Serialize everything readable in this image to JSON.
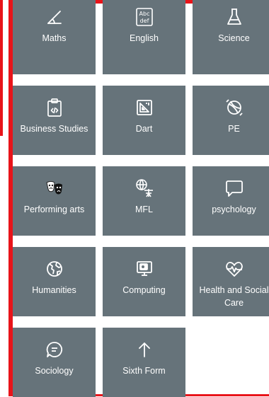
{
  "subjects": [
    {
      "label": "Maths",
      "icon": "angle-icon"
    },
    {
      "label": "English",
      "icon": "abc-def-icon"
    },
    {
      "label": "Science",
      "icon": "flask-icon"
    },
    {
      "label": "Business Studies",
      "icon": "clipboard-code-icon"
    },
    {
      "label": "Dart",
      "icon": "design-ruler-icon"
    },
    {
      "label": "PE",
      "icon": "ball-icon"
    },
    {
      "label": "Performing arts",
      "icon": "theatre-masks-icon"
    },
    {
      "label": "MFL",
      "icon": "globe-translate-icon"
    },
    {
      "label": "psychology",
      "icon": "speech-bubble-icon"
    },
    {
      "label": "Humanities",
      "icon": "globe-icon"
    },
    {
      "label": "Computing",
      "icon": "monitor-camera-icon"
    },
    {
      "label": "Health and Social Care",
      "icon": "heartbeat-icon"
    },
    {
      "label": "Sociology",
      "icon": "chat-icon"
    },
    {
      "label": "Sixth Form",
      "icon": "arrow-up-icon"
    }
  ],
  "colors": {
    "tile": "#66737a",
    "accent": "#e8141a",
    "text": "#ffffff"
  }
}
